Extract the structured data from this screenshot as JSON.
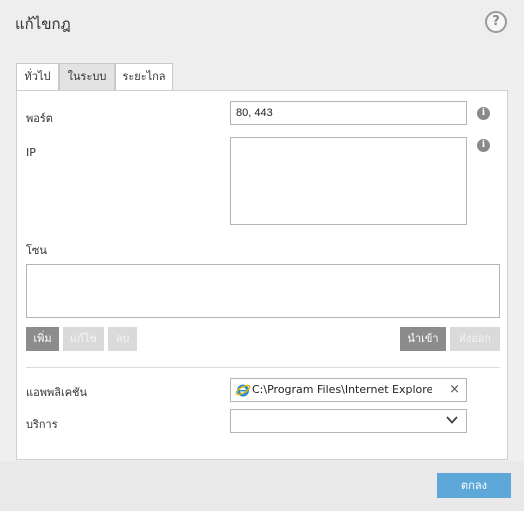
{
  "dialog": {
    "title": "แก้ไขกฎ",
    "help_icon": "?"
  },
  "tabs": [
    {
      "label": "ทั่วไป",
      "active": false
    },
    {
      "label": "ในระบบ",
      "active": true
    },
    {
      "label": "ระยะไกล",
      "active": false
    }
  ],
  "fields": {
    "port": {
      "label": "พอร์ต",
      "value": "80, 443"
    },
    "ip": {
      "label": "IP",
      "value": ""
    },
    "zone": {
      "label": "โซน"
    }
  },
  "zone_buttons": {
    "add": "เพิ่ม",
    "edit": "แก้ไข",
    "delete": "ลบ",
    "import": "นำเข้า",
    "export": "ส่งออก"
  },
  "application": {
    "label": "แอพพลิเคชัน",
    "value": "C:\\Program Files\\Internet Explorer\\i",
    "clear_icon": "×"
  },
  "service": {
    "label": "บริการ",
    "value": ""
  },
  "info_icon": "i",
  "footer": {
    "ok_label": "ตกลง"
  },
  "colors": {
    "accent": "#5da8d8",
    "button_active": "#8c8c8c",
    "button_disabled": "#dadada"
  }
}
